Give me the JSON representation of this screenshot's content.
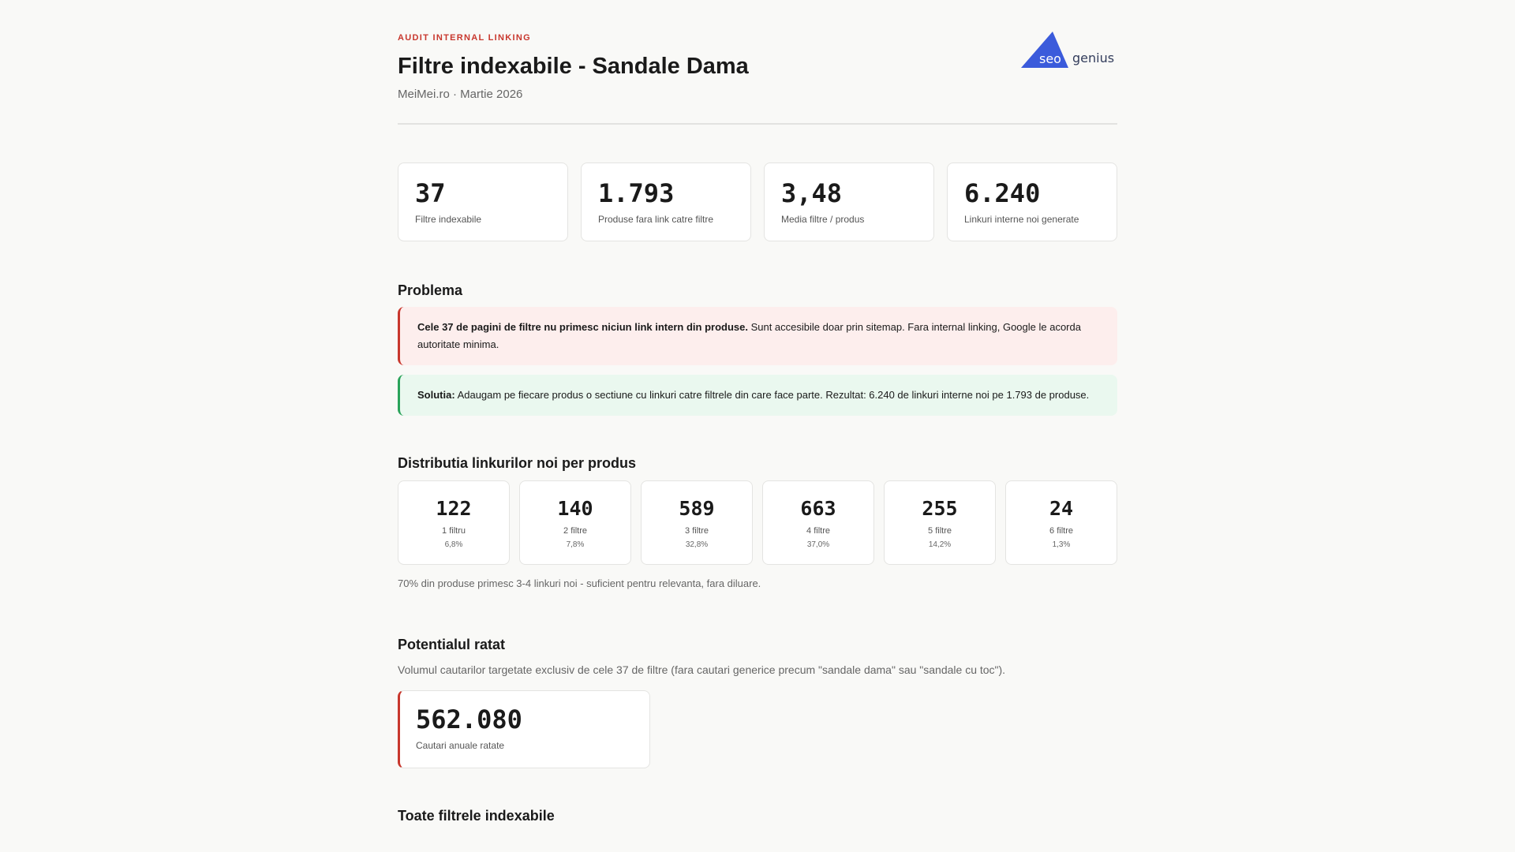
{
  "header": {
    "eyebrow": "AUDIT INTERNAL LINKING",
    "title": "Filtre indexabile - Sandale Dama",
    "subtitle": "MeiMei.ro · Martie 2026",
    "logo_text": "seo genius",
    "logo_color": "#3b5bdb"
  },
  "stats": [
    {
      "value": "37",
      "label": "Filtre indexabile"
    },
    {
      "value": "1.793",
      "label": "Produse fara link catre filtre"
    },
    {
      "value": "3,48",
      "label": "Media filtre / produs"
    },
    {
      "value": "6.240",
      "label": "Linkuri interne noi generate"
    }
  ],
  "problem": {
    "heading": "Problema",
    "red_bold": "Cele 37 de pagini de filtre nu primesc niciun link intern din produse.",
    "red_text": " Sunt accesibile doar prin sitemap. Fara internal linking, Google le acorda autoritate minima.",
    "green_bold": "Solutia:",
    "green_text": " Adaugam pe fiecare produs o sectiune cu linkuri catre filtrele din care face parte. Rezultat: 6.240 de linkuri interne noi pe 1.793 de produse."
  },
  "distribution": {
    "heading": "Distributia linkurilor noi per produs",
    "items": [
      {
        "value": "122",
        "label": "1 filtru",
        "pct": "6,8%"
      },
      {
        "value": "140",
        "label": "2 filtre",
        "pct": "7,8%"
      },
      {
        "value": "589",
        "label": "3 filtre",
        "pct": "32,8%"
      },
      {
        "value": "663",
        "label": "4 filtre",
        "pct": "37,0%"
      },
      {
        "value": "255",
        "label": "5 filtre",
        "pct": "14,2%"
      },
      {
        "value": "24",
        "label": "6 filtre",
        "pct": "1,3%"
      }
    ],
    "note": "70% din produse primesc 3-4 linkuri noi - suficient pentru relevanta, fara diluare."
  },
  "potential": {
    "heading": "Potentialul ratat",
    "desc": "Volumul cautarilor targetate exclusiv de cele 37 de filtre (fara cautari generice precum \"sandale dama\" sau \"sandale cu toc\").",
    "value": "562.080",
    "label": "Cautari anuale ratate"
  },
  "all_filters": {
    "heading": "Toate filtrele indexabile"
  }
}
